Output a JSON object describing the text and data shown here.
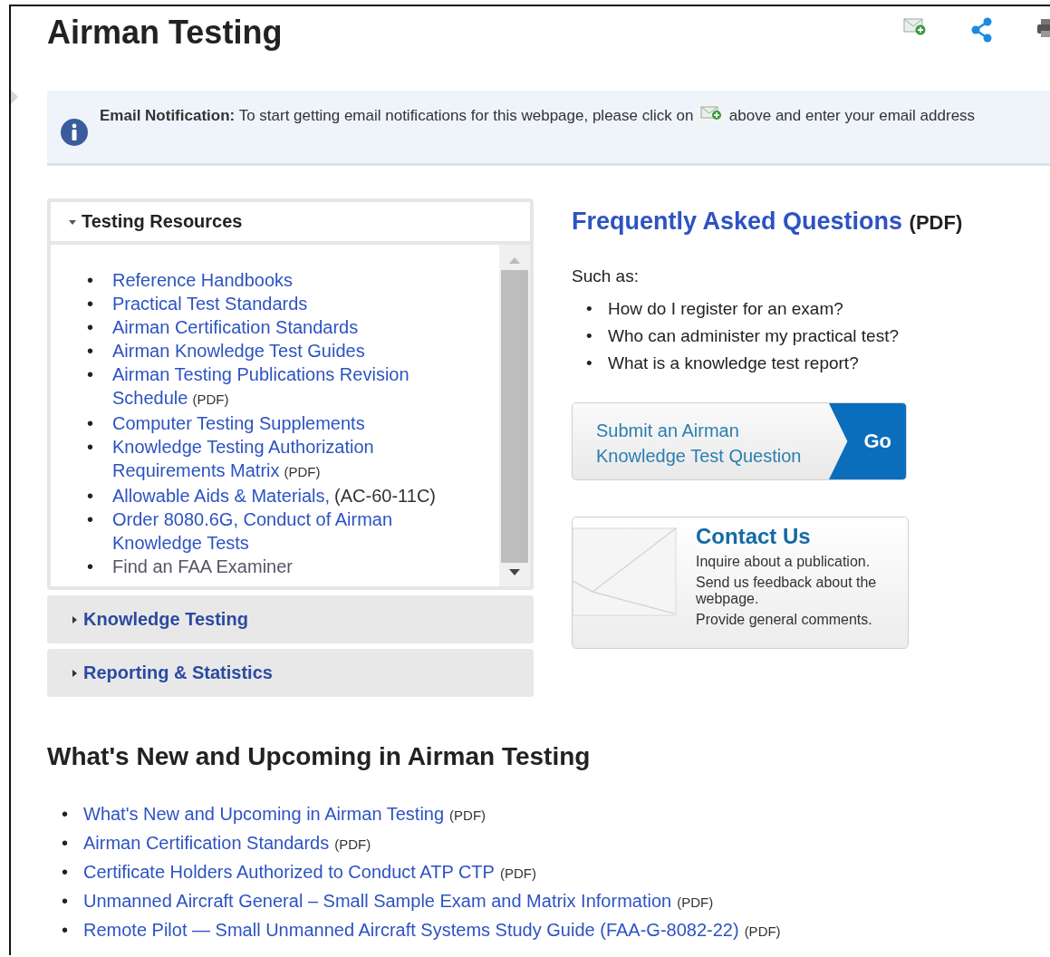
{
  "page_title": "Airman Testing",
  "notification": {
    "label": "Email Notification:",
    "text_before": "To start getting email notifications for this webpage, please click on",
    "text_after": "above and enter your email address"
  },
  "accordion": [
    {
      "title": "Testing Resources",
      "expanded": true,
      "links": [
        {
          "marker": "•",
          "text": "Reference Handbooks"
        },
        {
          "marker": "•",
          "text": "Practical Test Standards"
        },
        {
          "marker": "•",
          "text": "Airman Certification Standards"
        },
        {
          "marker": "•",
          "text": "Airman Knowledge Test Guides"
        },
        {
          "marker": "•",
          "text": "Airman Testing Publications Revision Schedule",
          "suffix": "(PDF)",
          "kind": "pdf"
        },
        {
          "marker": "•",
          "text": "Computer Testing Supplements"
        },
        {
          "marker": "•",
          "text": "Knowledge Testing Authorization Requirements Matrix",
          "suffix": "(PDF)",
          "kind": "pdf"
        },
        {
          "marker": "•",
          "text": "Allowable Aids & Materials,",
          "suffix": "(AC-60-11C)",
          "kind": "plain"
        },
        {
          "marker": "•",
          "text": "Order 8080.6G, Conduct of Airman Knowledge Tests"
        },
        {
          "marker": "•",
          "text": "Find an FAA Examiner"
        }
      ]
    },
    {
      "title": "Knowledge Testing",
      "expanded": false
    },
    {
      "title": "Reporting & Statistics",
      "expanded": false
    }
  ],
  "faq": {
    "title": "Frequently Asked Questions",
    "suffix": "(PDF)",
    "intro": "Such as:",
    "questions": [
      {
        "marker": "•",
        "text": "How do I register for an exam?"
      },
      {
        "marker": "•",
        "text": "Who can administer my practical test?"
      },
      {
        "marker": "•",
        "text": "What is a knowledge test report?"
      }
    ]
  },
  "submit_banner": {
    "text": "Submit an Airman Knowledge Test Question",
    "button": "Go"
  },
  "contact_banner": {
    "title": "Contact Us",
    "lines": [
      "Inquire about a publication.",
      "Send us feedback about the webpage.",
      "Provide general comments."
    ]
  },
  "whats_new": {
    "title": "What's New and Upcoming in Airman Testing",
    "links": [
      {
        "marker": "•",
        "text": "What's New and Upcoming in Airman Testing",
        "suffix": "(PDF)"
      },
      {
        "marker": "•",
        "text": "Airman Certification Standards",
        "suffix": "(PDF)"
      },
      {
        "marker": "•",
        "text": "Certificate Holders Authorized to Conduct ATP CTP",
        "suffix": "(PDF)"
      },
      {
        "marker": "•",
        "text": "Unmanned Aircraft General – Small Sample Exam and Matrix Information",
        "suffix": "(PDF)"
      },
      {
        "marker": "•",
        "text": "Remote Pilot — Small Unmanned Aircraft Systems Study Guide (FAA-G-8082-22)",
        "suffix": "(PDF)"
      }
    ]
  }
}
